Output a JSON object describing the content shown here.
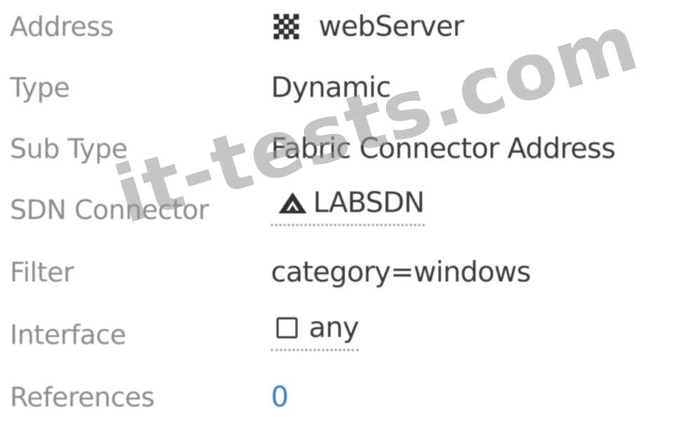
{
  "details": {
    "rows": [
      {
        "label": "Address",
        "value": "webServer",
        "icon": "address-grid-icon"
      },
      {
        "label": "Type",
        "value": "Dynamic"
      },
      {
        "label": "Sub Type",
        "value": "Fabric Connector Address"
      },
      {
        "label": "SDN Connector",
        "value": "LABSDN",
        "icon": "sdn-connector-icon"
      },
      {
        "label": "Filter",
        "value": "category=windows"
      },
      {
        "label": "Interface",
        "value": "any",
        "icon": "interface-icon"
      },
      {
        "label": "References",
        "value": "0"
      }
    ]
  },
  "watermark": "it-tests.com",
  "colors": {
    "label": "#8c8c8c",
    "value": "#3a3a3a",
    "link": "#3a7fb3",
    "watermark": "#969696"
  }
}
